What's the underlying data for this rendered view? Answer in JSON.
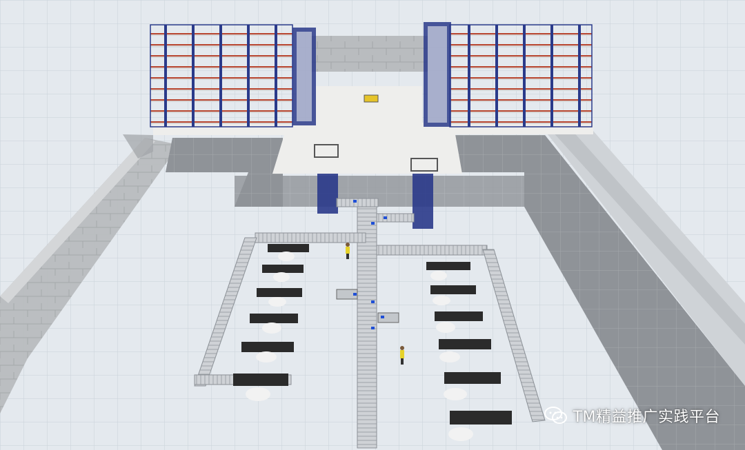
{
  "watermark": {
    "text": "TM精益推广实践平台",
    "logo_icon": "wechat-icon"
  },
  "colors": {
    "floor": "#e4e9ee",
    "grid": "#c9d1d8",
    "dark_floor": "#8d9196",
    "mezzanine": "#eeeeec",
    "rack_frame": "#2a3a8a",
    "rack_shelf": "#b8452f",
    "conveyor": "#c9ccd0",
    "workstation": "#2b2b2b",
    "worker_vest": "#e6d22a",
    "marker_blue": "#1f4fd6"
  }
}
